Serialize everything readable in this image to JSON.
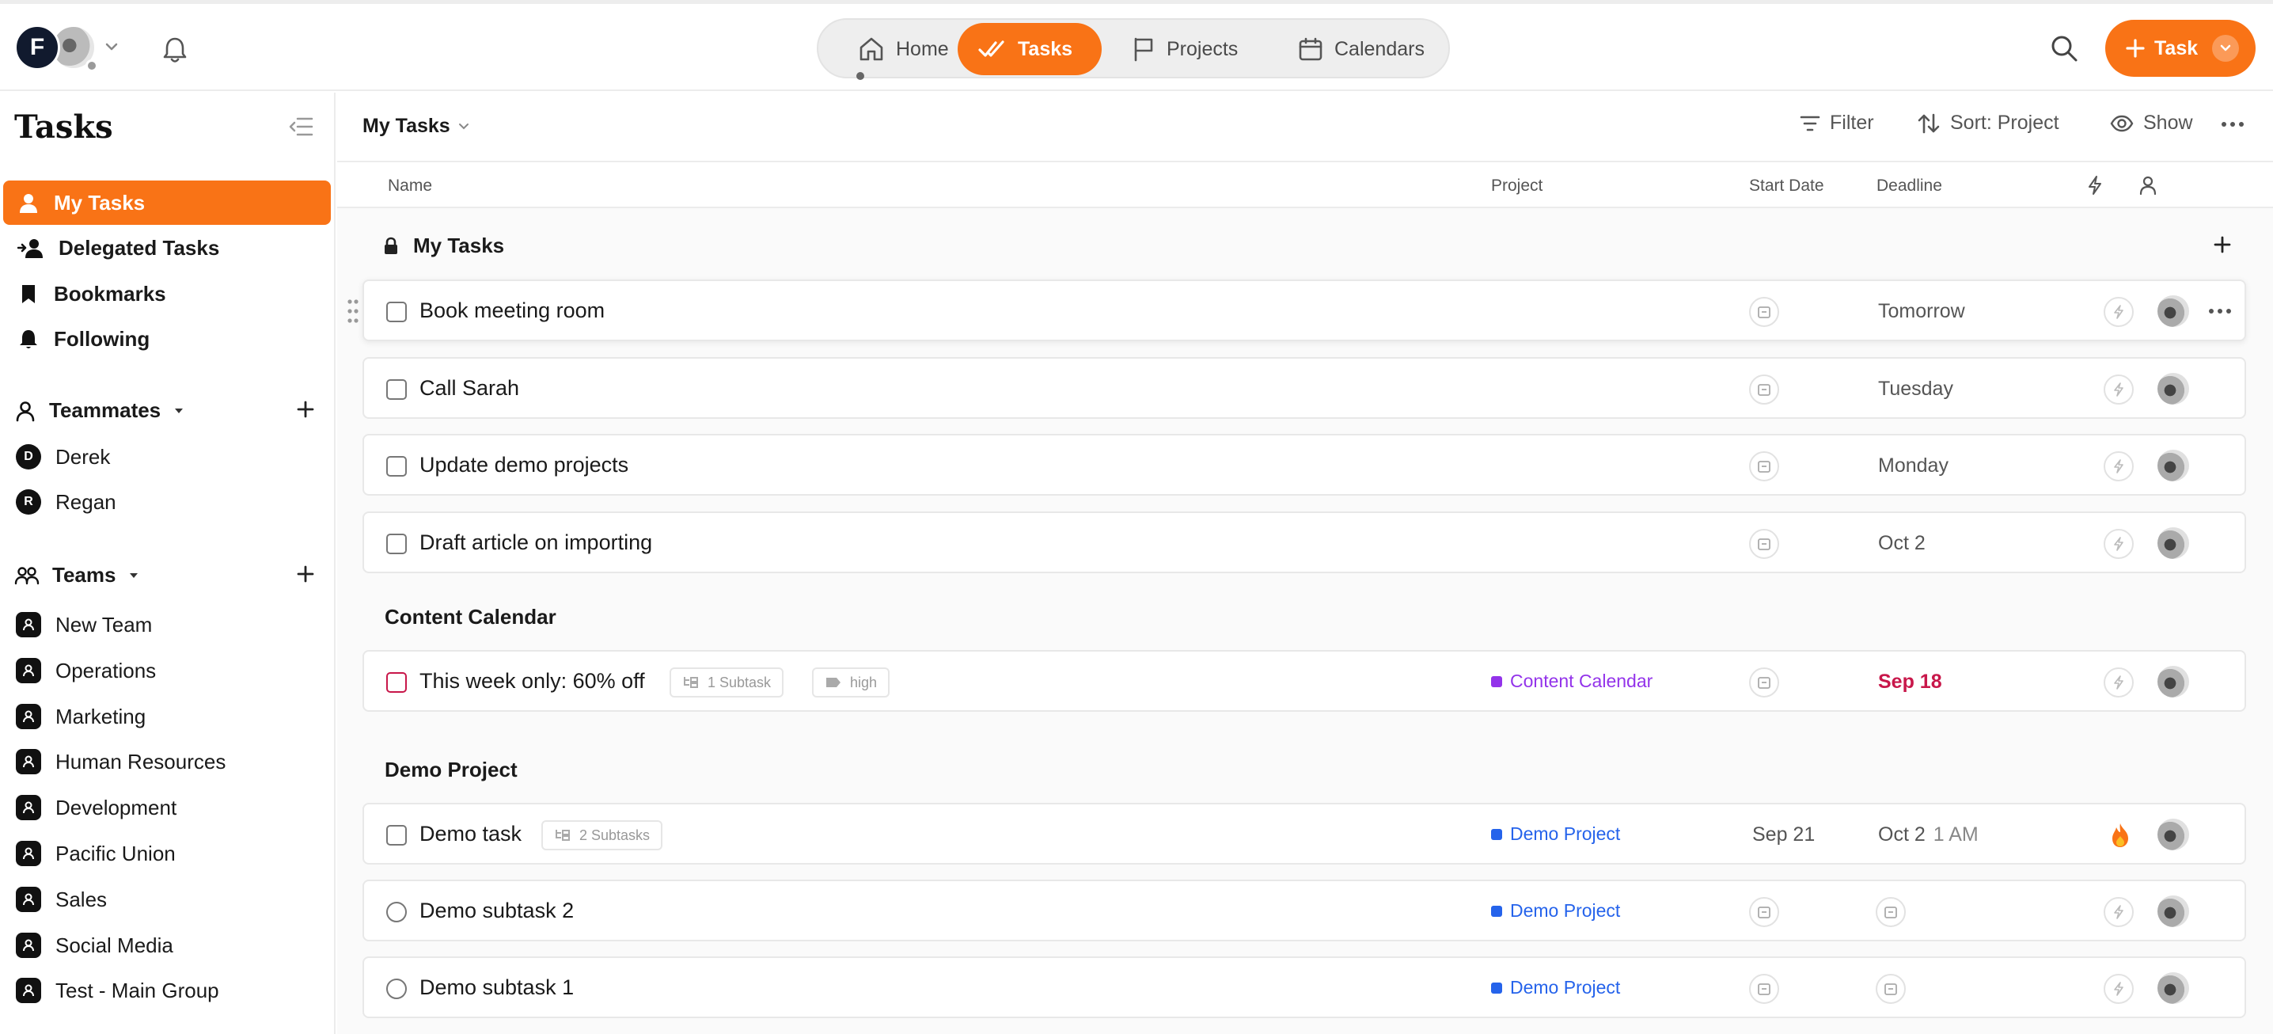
{
  "topbar": {
    "user_initial": "F",
    "nav": [
      {
        "label": "Home",
        "icon": "home-icon"
      },
      {
        "label": "Tasks",
        "icon": "double-check-icon"
      },
      {
        "label": "Projects",
        "icon": "flag-icon"
      },
      {
        "label": "Calendars",
        "icon": "calendar-icon"
      }
    ],
    "active_nav": "Tasks",
    "new_task_label": "Task"
  },
  "sidebar": {
    "title": "Tasks",
    "items": [
      {
        "label": "My Tasks",
        "icon": "person-icon",
        "active": true
      },
      {
        "label": "Delegated Tasks",
        "icon": "delegate-icon"
      },
      {
        "label": "Bookmarks",
        "icon": "bookmark-icon"
      },
      {
        "label": "Following",
        "icon": "bell-icon"
      }
    ],
    "teammates_label": "Teammates",
    "teammates": [
      {
        "initial": "D",
        "name": "Derek"
      },
      {
        "initial": "R",
        "name": "Regan"
      }
    ],
    "teams_label": "Teams",
    "teams": [
      "New Team",
      "Operations",
      "Marketing",
      "Human Resources",
      "Development",
      "Pacific Union",
      "Sales",
      "Social Media",
      "Test - Main Group"
    ]
  },
  "toolbar": {
    "view": "My Tasks",
    "filter_label": "Filter",
    "sort_label": "Sort: Project",
    "show_label": "Show"
  },
  "columns": {
    "name": "Name",
    "project": "Project",
    "start_date": "Start Date",
    "deadline": "Deadline"
  },
  "groups": [
    {
      "title": "My Tasks",
      "locked": true,
      "tasks": [
        {
          "name": "Book meeting room",
          "deadline": "Tomorrow"
        },
        {
          "name": "Call Sarah",
          "deadline": "Tuesday"
        },
        {
          "name": "Update demo projects",
          "deadline": "Monday"
        },
        {
          "name": "Draft article on importing",
          "deadline": "Oct 2"
        }
      ]
    },
    {
      "title": "Content Calendar",
      "tasks": [
        {
          "name": "This week only: 60% off",
          "subtasks": "1 Subtask",
          "tag": "high",
          "project": "Content Calendar",
          "deadline": "Sep 18",
          "overdue": true
        }
      ]
    },
    {
      "title": "Demo Project",
      "tasks": [
        {
          "name": "Demo task",
          "subtasks": "2 Subtasks",
          "project": "Demo Project",
          "start": "Sep 21",
          "deadline": "Oct 2",
          "deadline_time": "1 AM",
          "priority": "flame-icon"
        },
        {
          "name": "Demo subtask 2",
          "project": "Demo Project"
        },
        {
          "name": "Demo subtask 1",
          "project": "Demo Project"
        }
      ]
    }
  ],
  "colors": {
    "accent": "#f97316",
    "content_calendar": "#9333ea",
    "demo_project": "#2563eb",
    "overdue": "#c8174a"
  }
}
